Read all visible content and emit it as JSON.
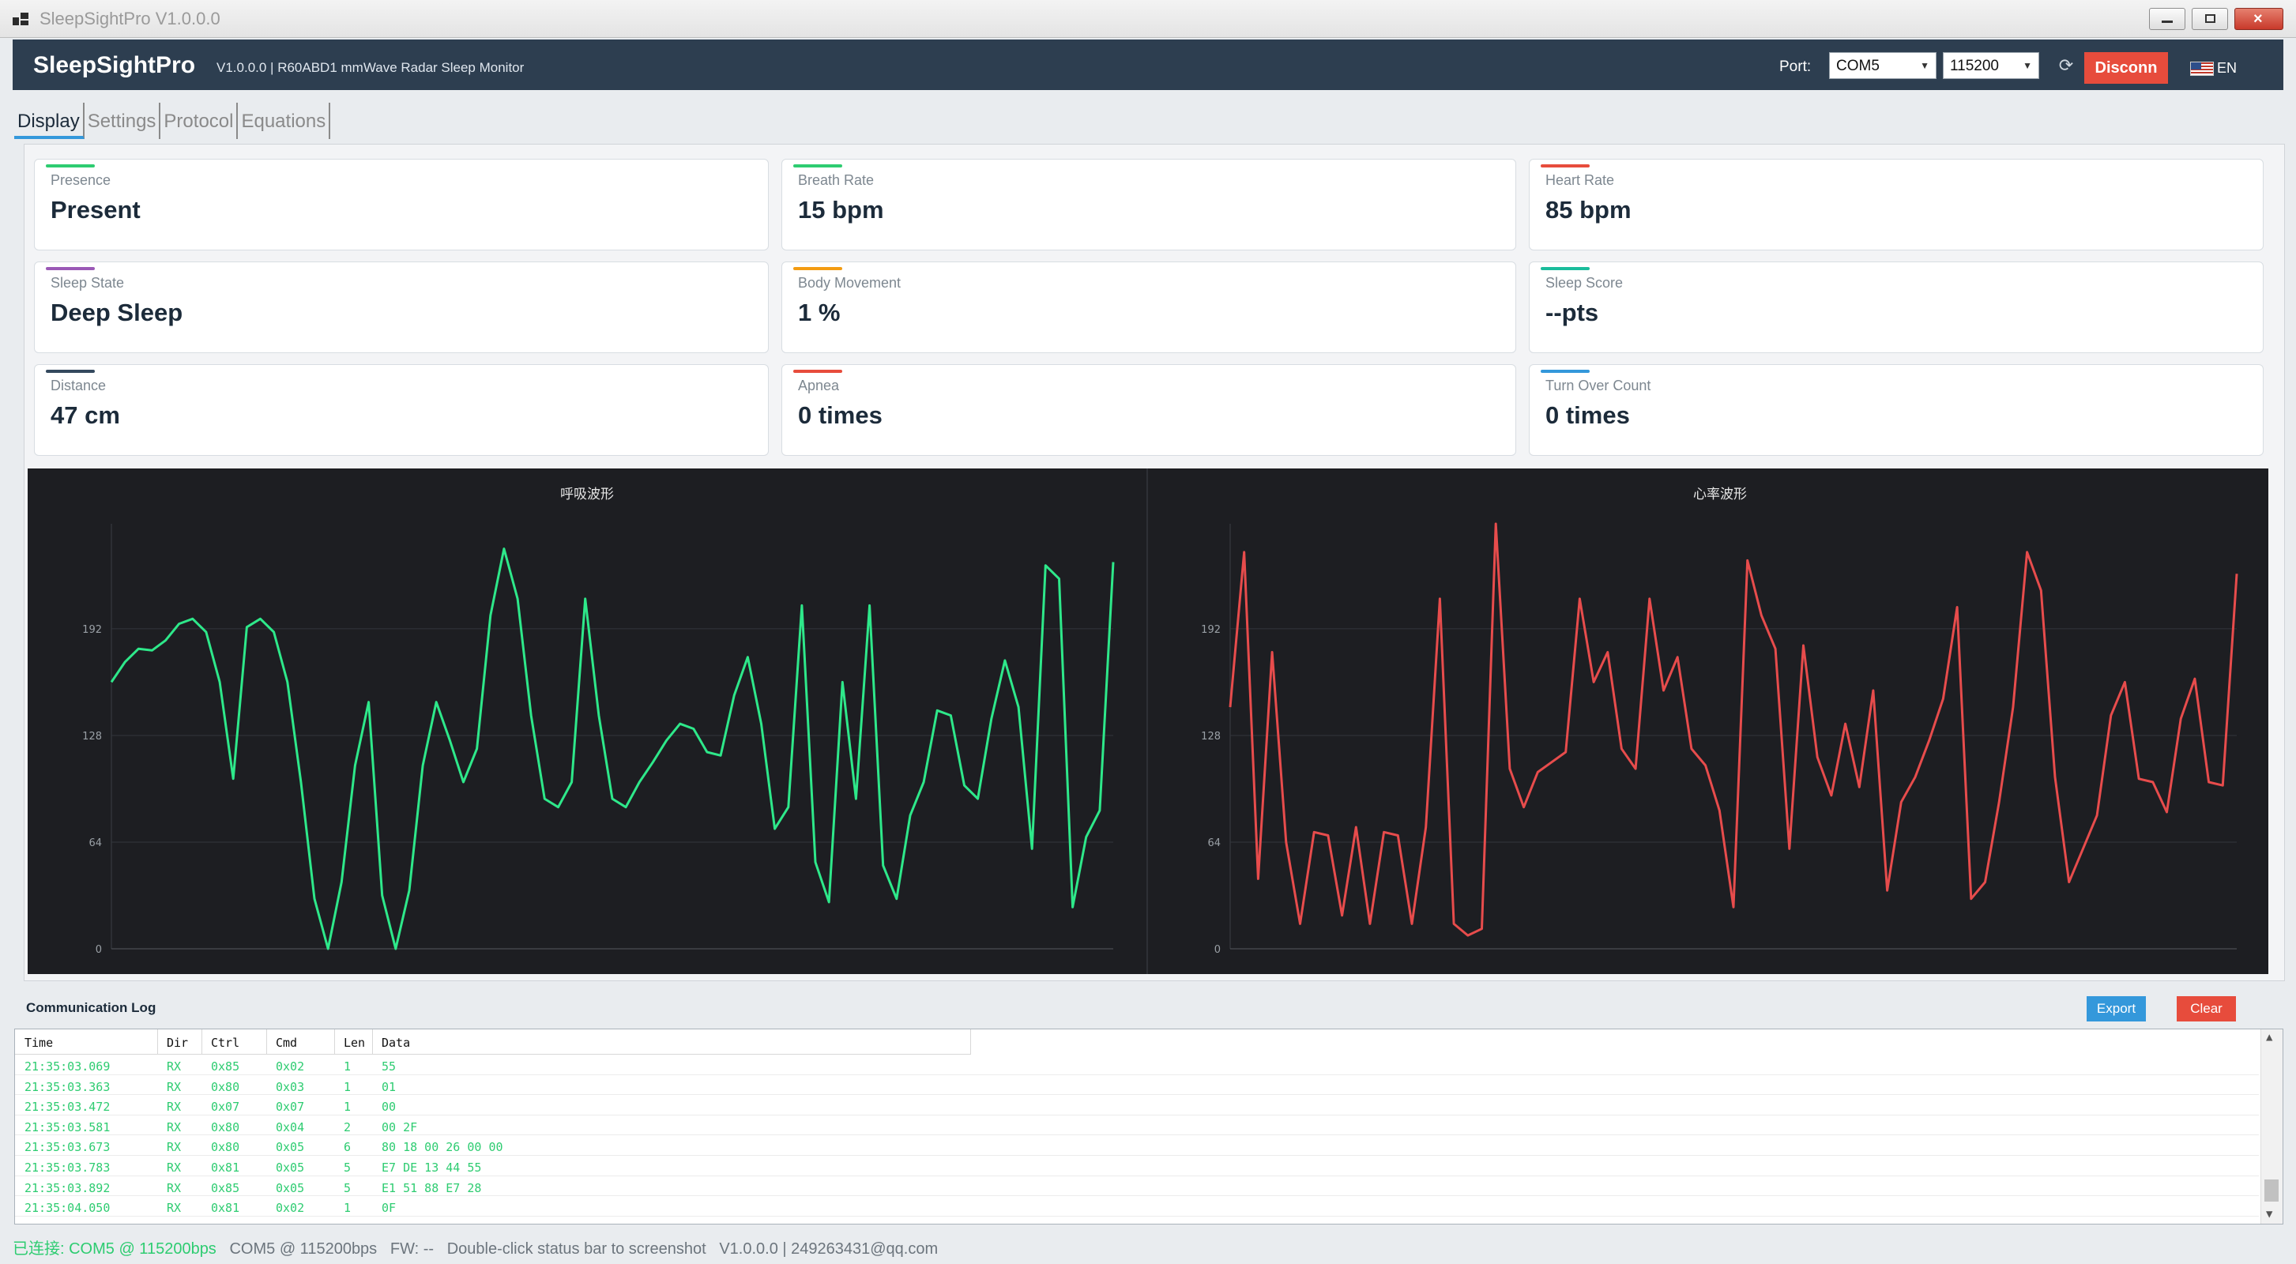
{
  "window": {
    "title": "SleepSightPro V1.0.0.0"
  },
  "header": {
    "brand": "SleepSightPro",
    "subtitle": "V1.0.0.0 | R60ABD1 mmWave Radar Sleep Monitor",
    "port_label": "Port:",
    "port_value": "COM5",
    "baud_value": "115200",
    "disconnect_label": "Disconn",
    "language": "EN",
    "colors": {
      "bar": "#2d3e50",
      "disconnect": "#e74c3c"
    }
  },
  "tabs": [
    {
      "label": "Display",
      "active": true
    },
    {
      "label": "Settings",
      "active": false
    },
    {
      "label": "Protocol",
      "active": false
    },
    {
      "label": "Equations",
      "active": false
    }
  ],
  "cards": [
    {
      "label": "Presence",
      "value": "Present",
      "color": "#2ecc71"
    },
    {
      "label": "Breath Rate",
      "value": "15 bpm",
      "color": "#2ecc71"
    },
    {
      "label": "Heart Rate",
      "value": "85 bpm",
      "color": "#e74c3c"
    },
    {
      "label": "Sleep State",
      "value": "Deep Sleep",
      "color": "#9b59b6"
    },
    {
      "label": "Body Movement",
      "value": "1 %",
      "color": "#f39c12"
    },
    {
      "label": "Sleep Score",
      "value": "--pts",
      "color": "#1abc9c"
    },
    {
      "label": "Distance",
      "value": "47 cm",
      "color": "#34495e"
    },
    {
      "label": "Apnea",
      "value": "0 times",
      "color": "#e74c3c"
    },
    {
      "label": "Turn Over Count",
      "value": "0 times",
      "color": "#3498db"
    }
  ],
  "chart_data": [
    {
      "type": "line",
      "title": "呼吸波形",
      "color": "#2ee88a",
      "ylim": [
        0,
        255
      ],
      "yticks": [
        "0",
        "64",
        "128",
        "192"
      ],
      "yticks_values": [
        0,
        64,
        128,
        192
      ],
      "grid": true,
      "values": [
        160,
        172,
        180,
        179,
        185,
        195,
        198,
        190,
        160,
        102,
        193,
        198,
        190,
        160,
        100,
        30,
        0,
        40,
        110,
        148,
        32,
        0,
        35,
        110,
        148,
        125,
        100,
        120,
        200,
        240,
        210,
        140,
        90,
        85,
        100,
        210,
        140,
        90,
        85,
        100,
        112,
        125,
        135,
        132,
        118,
        116,
        152,
        175,
        135,
        72,
        85,
        206,
        52,
        28,
        160,
        90,
        206,
        50,
        30,
        80,
        100,
        143,
        140,
        98,
        90,
        138,
        173,
        145,
        60,
        230,
        222,
        25,
        67,
        83,
        232
      ]
    },
    {
      "type": "line",
      "title": "心率波形",
      "color": "#e74c4c",
      "ylim": [
        0,
        255
      ],
      "yticks": [
        "0",
        "64",
        "128",
        "192"
      ],
      "yticks_values": [
        0,
        64,
        128,
        192
      ],
      "grid": true,
      "values": [
        145,
        238,
        42,
        178,
        64,
        15,
        70,
        68,
        20,
        73,
        15,
        70,
        68,
        15,
        73,
        210,
        15,
        8,
        12,
        255,
        108,
        85,
        106,
        112,
        118,
        210,
        160,
        178,
        120,
        108,
        210,
        155,
        175,
        120,
        110,
        83,
        25,
        233,
        200,
        180,
        60,
        182,
        115,
        92,
        135,
        97,
        155,
        35,
        88,
        103,
        125,
        150,
        205,
        30,
        40,
        88,
        145,
        238,
        215,
        103,
        40,
        60,
        80,
        140,
        160,
        102,
        100,
        82,
        138,
        162,
        100,
        98,
        225
      ]
    }
  ],
  "log": {
    "title": "Communication Log",
    "export_label": "Export",
    "clear_label": "Clear",
    "columns": [
      "Time",
      "Dir",
      "Ctrl",
      "Cmd",
      "Len",
      "Data"
    ],
    "rows": [
      [
        "21:35:03.069",
        "RX",
        "0x85",
        "0x02",
        "1",
        "55"
      ],
      [
        "21:35:03.363",
        "RX",
        "0x80",
        "0x03",
        "1",
        "01"
      ],
      [
        "21:35:03.472",
        "RX",
        "0x07",
        "0x07",
        "1",
        "00"
      ],
      [
        "21:35:03.581",
        "RX",
        "0x80",
        "0x04",
        "2",
        "00 2F"
      ],
      [
        "21:35:03.673",
        "RX",
        "0x80",
        "0x05",
        "6",
        "80 18 00 26 00 00"
      ],
      [
        "21:35:03.783",
        "RX",
        "0x81",
        "0x05",
        "5",
        "E7 DE 13 44 55"
      ],
      [
        "21:35:03.892",
        "RX",
        "0x85",
        "0x05",
        "5",
        "E1 51 88 E7 28"
      ],
      [
        "21:35:04.050",
        "RX",
        "0x81",
        "0x02",
        "1",
        "0F"
      ]
    ]
  },
  "status": {
    "connected": "已连接: COM5 @ 115200bps",
    "info": "COM5 @ 115200bps",
    "fw": "FW: --",
    "hint": "Double-click status bar to screenshot",
    "version": "V1.0.0.0 | 249263431@qq.com"
  }
}
